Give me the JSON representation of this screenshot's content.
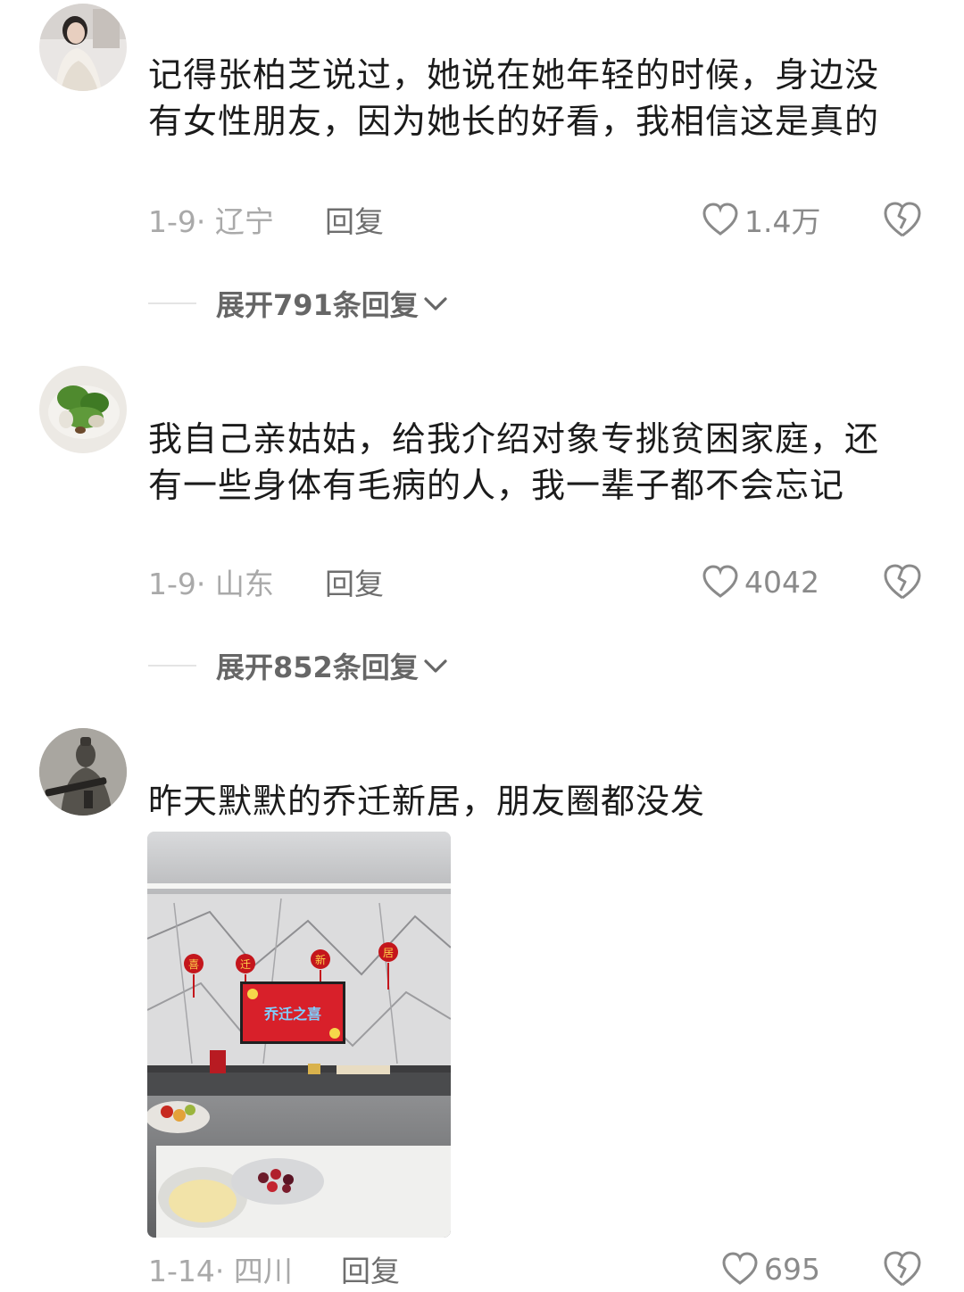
{
  "comments": [
    {
      "text": "记得张柏芝说过，她说在她年轻的时候，身边没有女性朋友，因为她长的好看，我相信这是真的",
      "date_location": "1-9· 辽宁",
      "reply_label": "回复",
      "likes": "1.4万",
      "expand_label": "展开791条回复"
    },
    {
      "text": "我自己亲姑姑，给我介绍对象专挑贫困家庭，还有一些身体有毛病的人，我一辈子都不会忘记",
      "date_location": "1-9· 山东",
      "reply_label": "回复",
      "likes": "4042",
      "expand_label": "展开852条回复"
    },
    {
      "text": "昨天默默的乔迁新居，朋友圈都没发",
      "date_location": "1-14· 四川",
      "reply_label": "回复",
      "likes": "695",
      "photo_tv_text": "乔迁之喜",
      "photo_lantern_chars": [
        "喜",
        "迁",
        "新",
        "居"
      ]
    }
  ],
  "icons": {
    "like": "heart-outline-icon",
    "dislike": "broken-heart-icon",
    "expand": "chevron-down-icon"
  },
  "colors": {
    "text_primary": "#1b1b1b",
    "text_meta": "#a9a9a9",
    "reply": "#6e6e6e",
    "expand": "#666666",
    "tv_red": "#d8202a"
  }
}
